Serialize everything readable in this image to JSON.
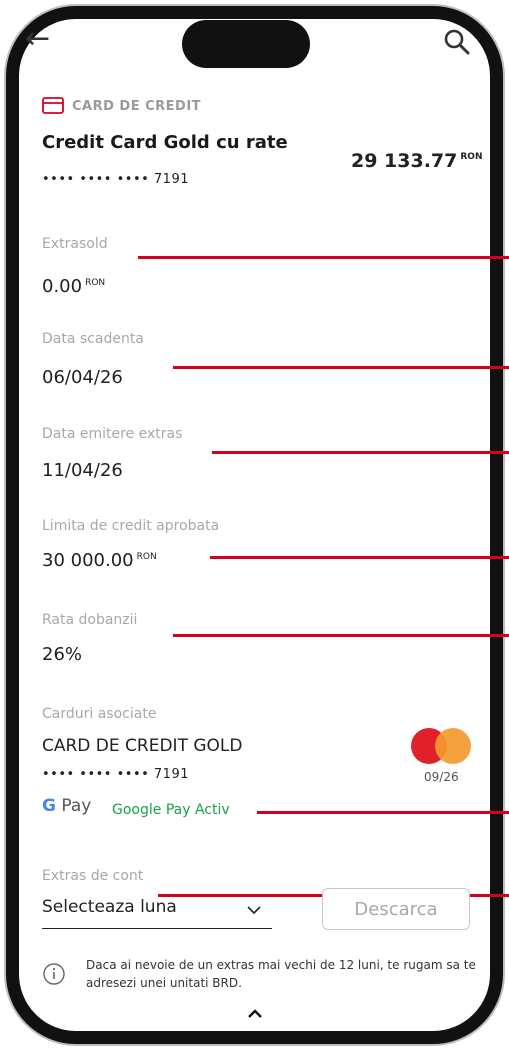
{
  "header": {
    "back_icon": "arrow-left-icon",
    "search_icon": "search-icon"
  },
  "account": {
    "type_label": "CARD DE CREDIT",
    "name": "Credit Card Gold cu rate",
    "masked_number": "•••• •••• •••• 7191",
    "balance": "29 133.77",
    "balance_currency": "RON"
  },
  "fields": [
    {
      "label": "Extrasold",
      "value": "0.00",
      "currency": "RON"
    },
    {
      "label": "Data scadenta",
      "value": "06/04/26"
    },
    {
      "label": "Data emitere extras",
      "value": "11/04/26"
    },
    {
      "label": "Limita de credit aprobata",
      "value": "30 000.00",
      "currency": "RON"
    },
    {
      "label": "Rata dobanzii",
      "value": "26%"
    }
  ],
  "cards": {
    "label": "Carduri asociate",
    "name": "CARD DE CREDIT GOLD",
    "masked_number": "•••• •••• •••• 7191",
    "expiry": "09/26",
    "gpay_logo_g": "G",
    "gpay_logo_pay": "Pay",
    "gpay_status": "Google Pay Activ",
    "brand_colors": {
      "mc_red": "#e0202b",
      "mc_orange": "#f29a2e"
    }
  },
  "statement": {
    "label": "Extras de cont",
    "select_value": "Selecteaza luna",
    "download_label": "Descarca",
    "info_text": "Daca ai nevoie de un extras mai vechi de 12 luni, te rugam sa te adresezi unei unitati BRD."
  },
  "colors": {
    "accent": "#d4001f",
    "muted": "#a8a8a8",
    "green": "#16a34a"
  }
}
